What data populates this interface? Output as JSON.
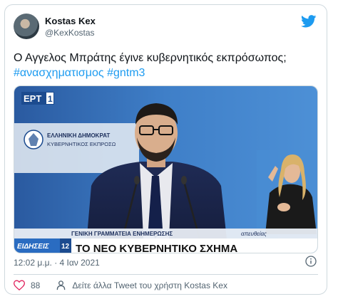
{
  "author": {
    "display_name": "Kostas Kex",
    "handle": "@KexKostas"
  },
  "tweet": {
    "text": "Ο Αγγελος Μπράτης έγινε κυβερνητικός εκπρόσωπος;",
    "hashtags": [
      "#ανασχηματισμος",
      "#gntm3"
    ],
    "timestamp": "12:02 μ.μ. · 4 Ιαν 2021"
  },
  "media": {
    "channel_logo": "ΕΡΤ",
    "channel_number": "1",
    "podium_line1": "ΕΛΛΗΝΙΚΗ ΔΗΜΟΚΡΑΤ",
    "podium_line2": "ΚΥΒΕΡΝΗΤΙΚΟΣ ΕΚΠΡΟΣΩ",
    "news_label": "ΕΙΔΗΣΕΙΣ",
    "news_channel": "12",
    "lower_third_top": "ΓΕΝΙΚΗ ΓΡΑΜΜΑΤΕΙΑ ΕΝΗΜΕΡΩΣΗΣ",
    "lower_third_live": "απευθείας",
    "headline": "ΤΟ ΝΕΟ ΚΥΒΕΡΝΗΤΙΚΟ ΣΧΗΜΑ"
  },
  "footer": {
    "like_count": "88",
    "more_tweets_label": "Δείτε άλλα Tweet του χρήστη Kostas Kex"
  },
  "colors": {
    "link": "#1d9bf0",
    "like_red": "#e0245e",
    "ert_blue": "#1c4b8f",
    "studio_blue": "#3f7fc8"
  },
  "icons": [
    "twitter-bird-icon",
    "info-icon",
    "heart-icon",
    "person-icon",
    "coat-of-arms-icon"
  ]
}
